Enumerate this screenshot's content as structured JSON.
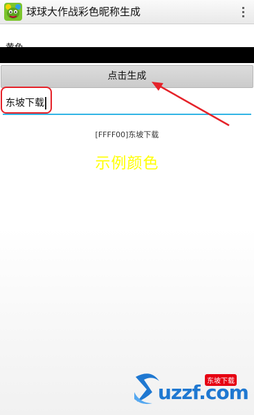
{
  "app": {
    "title": "球球大作战彩色昵称生成",
    "icon": "green-monster-app-icon"
  },
  "menu": {
    "icon": "overflow-menu-icon"
  },
  "form": {
    "color_label": "黄色",
    "color_bar_color": "#000000",
    "generate_label": "点击生成",
    "input_value": "东坡下载",
    "input_underline_color": "#33b5e5"
  },
  "result": {
    "code_text": "[FFFF00]东坡下载",
    "sample_text": "示例颜色",
    "sample_color": "#ffff00"
  },
  "annotation": {
    "color": "#e52229"
  },
  "watermark": {
    "tag": "东坡下载",
    "text": "uzzf.com"
  }
}
